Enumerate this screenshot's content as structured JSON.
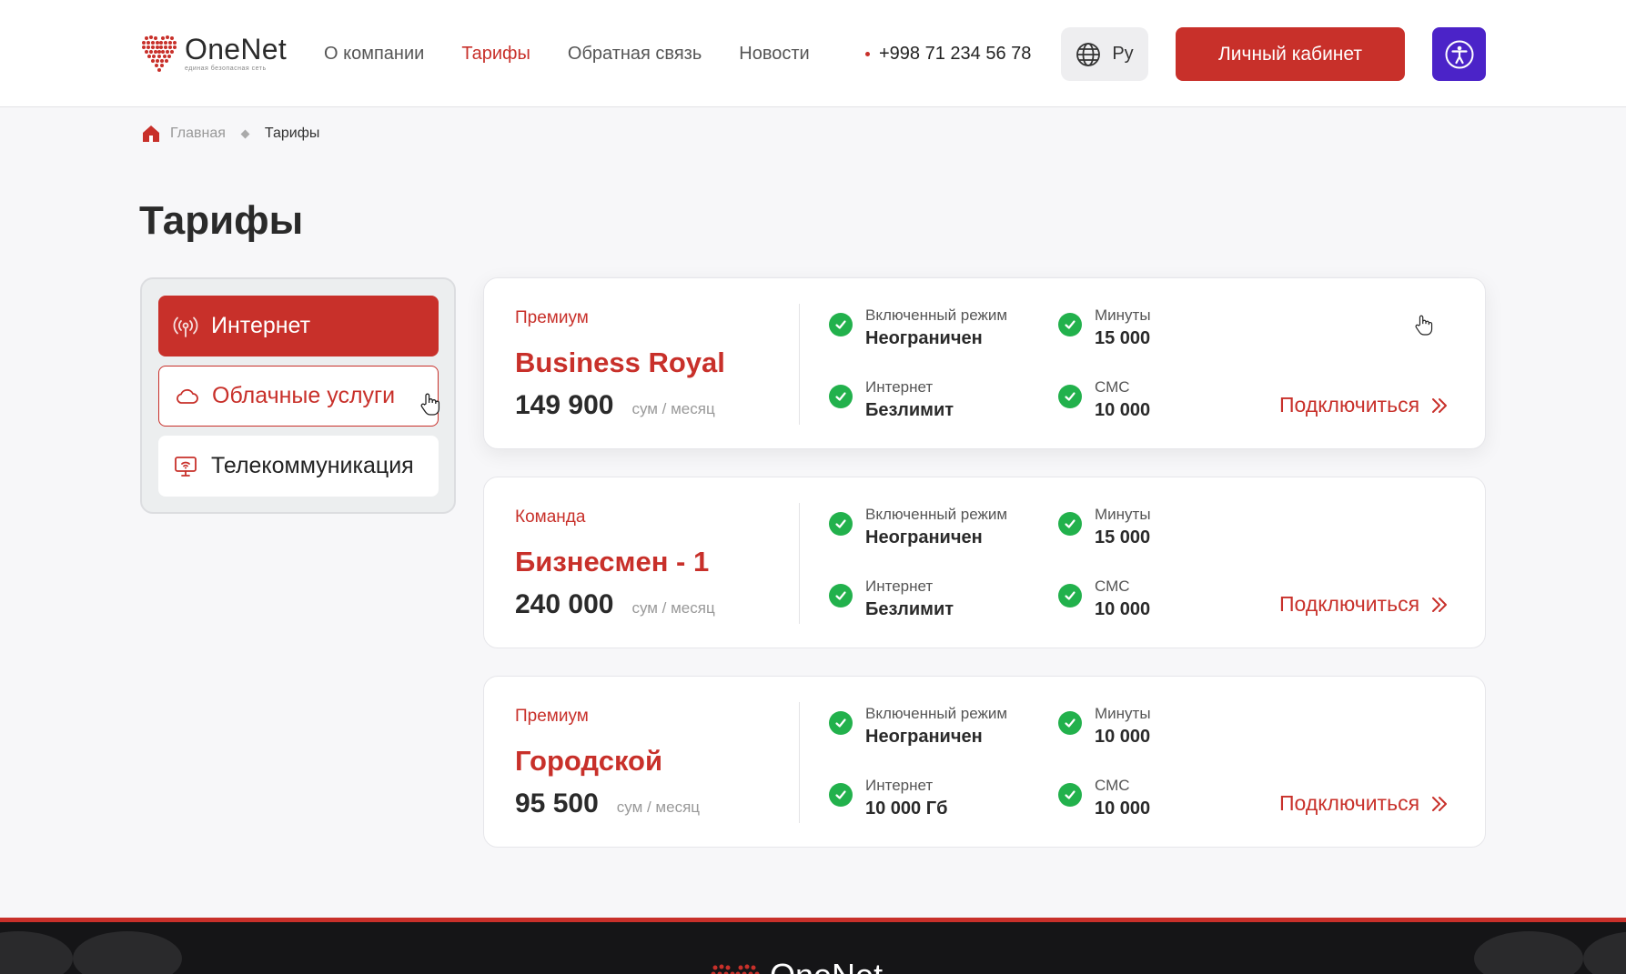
{
  "header": {
    "logo_title": "OneNet",
    "logo_subtitle": "единая безопасная сеть",
    "nav": [
      {
        "label": "О компании",
        "active": false
      },
      {
        "label": "Тарифы",
        "active": true
      },
      {
        "label": "Обратная связь",
        "active": false
      },
      {
        "label": "Новости",
        "active": false
      }
    ],
    "phone": "+998 71 234 56 78",
    "lang": "Ру",
    "cabinet_label": "Личный кабинет",
    "accessibility_icon": "accessibility-icon"
  },
  "breadcrumb": {
    "home": "Главная",
    "current": "Тарифы"
  },
  "page_title": "Тарифы",
  "sidebar": {
    "items": [
      {
        "label": "Интернет",
        "icon": "antenna-icon",
        "state": "active"
      },
      {
        "label": "Облачные услуги",
        "icon": "cloud-icon",
        "state": "hover"
      },
      {
        "label": "Телекоммуникация",
        "icon": "monitor-icon",
        "state": "normal"
      }
    ]
  },
  "tariffs": [
    {
      "type": "Премиум",
      "name": "Business Royal",
      "price": "149 900",
      "unit": "сум / месяц",
      "features": {
        "mode_label": "Включенный режим",
        "mode_value": "Неограничен",
        "internet_label": "Интернет",
        "internet_value": "Безлимит",
        "minutes_label": "Минуты",
        "minutes_value": "15 000",
        "sms_label": "СМС",
        "sms_value": "10 000"
      },
      "connect_label": "Подключиться"
    },
    {
      "type": "Команда",
      "name": "Бизнесмен - 1",
      "price": "240 000",
      "unit": "сум / месяц",
      "features": {
        "mode_label": "Включенный режим",
        "mode_value": "Неограничен",
        "internet_label": "Интернет",
        "internet_value": "Безлимит",
        "minutes_label": "Минуты",
        "minutes_value": "15 000",
        "sms_label": "СМС",
        "sms_value": "10 000"
      },
      "connect_label": "Подключиться"
    },
    {
      "type": "Премиум",
      "name": "Городской",
      "price": "95 500",
      "unit": "сум / месяц",
      "features": {
        "mode_label": "Включенный режим",
        "mode_value": "Неограничен",
        "internet_label": "Интернет",
        "internet_value": "10 000 Гб",
        "minutes_label": "Минуты",
        "minutes_value": "10 000",
        "sms_label": "СМС",
        "sms_value": "10 000"
      },
      "connect_label": "Подключиться"
    }
  ],
  "footer": {
    "logo_title": "OneNet"
  },
  "colors": {
    "brand_red": "#c8302a",
    "accessibility_purple": "#4b23c8",
    "check_green": "#22b14c"
  }
}
